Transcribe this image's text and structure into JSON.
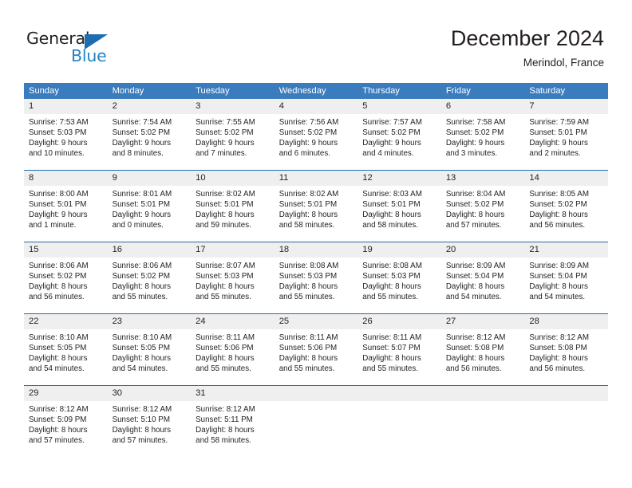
{
  "brand": {
    "name_top": "General",
    "name_bottom": "Blue",
    "triangle_color": "#1f6cb0",
    "blue_color": "#2283c5"
  },
  "header": {
    "title": "December 2024",
    "subtitle": "Merindol, France"
  },
  "theme": {
    "header_bg": "#3a7cbe",
    "header_text": "#ffffff",
    "week_rule": "#1f6cb0",
    "daynum_bg": "#efefef",
    "text": "#231f20"
  },
  "weekday_headers": [
    "Sunday",
    "Monday",
    "Tuesday",
    "Wednesday",
    "Thursday",
    "Friday",
    "Saturday"
  ],
  "weeks": [
    [
      {
        "day": "1",
        "sunrise": "Sunrise: 7:53 AM",
        "sunset": "Sunset: 5:03 PM",
        "daylight_1": "Daylight: 9 hours",
        "daylight_2": "and 10 minutes."
      },
      {
        "day": "2",
        "sunrise": "Sunrise: 7:54 AM",
        "sunset": "Sunset: 5:02 PM",
        "daylight_1": "Daylight: 9 hours",
        "daylight_2": "and 8 minutes."
      },
      {
        "day": "3",
        "sunrise": "Sunrise: 7:55 AM",
        "sunset": "Sunset: 5:02 PM",
        "daylight_1": "Daylight: 9 hours",
        "daylight_2": "and 7 minutes."
      },
      {
        "day": "4",
        "sunrise": "Sunrise: 7:56 AM",
        "sunset": "Sunset: 5:02 PM",
        "daylight_1": "Daylight: 9 hours",
        "daylight_2": "and 6 minutes."
      },
      {
        "day": "5",
        "sunrise": "Sunrise: 7:57 AM",
        "sunset": "Sunset: 5:02 PM",
        "daylight_1": "Daylight: 9 hours",
        "daylight_2": "and 4 minutes."
      },
      {
        "day": "6",
        "sunrise": "Sunrise: 7:58 AM",
        "sunset": "Sunset: 5:02 PM",
        "daylight_1": "Daylight: 9 hours",
        "daylight_2": "and 3 minutes."
      },
      {
        "day": "7",
        "sunrise": "Sunrise: 7:59 AM",
        "sunset": "Sunset: 5:01 PM",
        "daylight_1": "Daylight: 9 hours",
        "daylight_2": "and 2 minutes."
      }
    ],
    [
      {
        "day": "8",
        "sunrise": "Sunrise: 8:00 AM",
        "sunset": "Sunset: 5:01 PM",
        "daylight_1": "Daylight: 9 hours",
        "daylight_2": "and 1 minute."
      },
      {
        "day": "9",
        "sunrise": "Sunrise: 8:01 AM",
        "sunset": "Sunset: 5:01 PM",
        "daylight_1": "Daylight: 9 hours",
        "daylight_2": "and 0 minutes."
      },
      {
        "day": "10",
        "sunrise": "Sunrise: 8:02 AM",
        "sunset": "Sunset: 5:01 PM",
        "daylight_1": "Daylight: 8 hours",
        "daylight_2": "and 59 minutes."
      },
      {
        "day": "11",
        "sunrise": "Sunrise: 8:02 AM",
        "sunset": "Sunset: 5:01 PM",
        "daylight_1": "Daylight: 8 hours",
        "daylight_2": "and 58 minutes."
      },
      {
        "day": "12",
        "sunrise": "Sunrise: 8:03 AM",
        "sunset": "Sunset: 5:01 PM",
        "daylight_1": "Daylight: 8 hours",
        "daylight_2": "and 58 minutes."
      },
      {
        "day": "13",
        "sunrise": "Sunrise: 8:04 AM",
        "sunset": "Sunset: 5:02 PM",
        "daylight_1": "Daylight: 8 hours",
        "daylight_2": "and 57 minutes."
      },
      {
        "day": "14",
        "sunrise": "Sunrise: 8:05 AM",
        "sunset": "Sunset: 5:02 PM",
        "daylight_1": "Daylight: 8 hours",
        "daylight_2": "and 56 minutes."
      }
    ],
    [
      {
        "day": "15",
        "sunrise": "Sunrise: 8:06 AM",
        "sunset": "Sunset: 5:02 PM",
        "daylight_1": "Daylight: 8 hours",
        "daylight_2": "and 56 minutes."
      },
      {
        "day": "16",
        "sunrise": "Sunrise: 8:06 AM",
        "sunset": "Sunset: 5:02 PM",
        "daylight_1": "Daylight: 8 hours",
        "daylight_2": "and 55 minutes."
      },
      {
        "day": "17",
        "sunrise": "Sunrise: 8:07 AM",
        "sunset": "Sunset: 5:03 PM",
        "daylight_1": "Daylight: 8 hours",
        "daylight_2": "and 55 minutes."
      },
      {
        "day": "18",
        "sunrise": "Sunrise: 8:08 AM",
        "sunset": "Sunset: 5:03 PM",
        "daylight_1": "Daylight: 8 hours",
        "daylight_2": "and 55 minutes."
      },
      {
        "day": "19",
        "sunrise": "Sunrise: 8:08 AM",
        "sunset": "Sunset: 5:03 PM",
        "daylight_1": "Daylight: 8 hours",
        "daylight_2": "and 55 minutes."
      },
      {
        "day": "20",
        "sunrise": "Sunrise: 8:09 AM",
        "sunset": "Sunset: 5:04 PM",
        "daylight_1": "Daylight: 8 hours",
        "daylight_2": "and 54 minutes."
      },
      {
        "day": "21",
        "sunrise": "Sunrise: 8:09 AM",
        "sunset": "Sunset: 5:04 PM",
        "daylight_1": "Daylight: 8 hours",
        "daylight_2": "and 54 minutes."
      }
    ],
    [
      {
        "day": "22",
        "sunrise": "Sunrise: 8:10 AM",
        "sunset": "Sunset: 5:05 PM",
        "daylight_1": "Daylight: 8 hours",
        "daylight_2": "and 54 minutes."
      },
      {
        "day": "23",
        "sunrise": "Sunrise: 8:10 AM",
        "sunset": "Sunset: 5:05 PM",
        "daylight_1": "Daylight: 8 hours",
        "daylight_2": "and 54 minutes."
      },
      {
        "day": "24",
        "sunrise": "Sunrise: 8:11 AM",
        "sunset": "Sunset: 5:06 PM",
        "daylight_1": "Daylight: 8 hours",
        "daylight_2": "and 55 minutes."
      },
      {
        "day": "25",
        "sunrise": "Sunrise: 8:11 AM",
        "sunset": "Sunset: 5:06 PM",
        "daylight_1": "Daylight: 8 hours",
        "daylight_2": "and 55 minutes."
      },
      {
        "day": "26",
        "sunrise": "Sunrise: 8:11 AM",
        "sunset": "Sunset: 5:07 PM",
        "daylight_1": "Daylight: 8 hours",
        "daylight_2": "and 55 minutes."
      },
      {
        "day": "27",
        "sunrise": "Sunrise: 8:12 AM",
        "sunset": "Sunset: 5:08 PM",
        "daylight_1": "Daylight: 8 hours",
        "daylight_2": "and 56 minutes."
      },
      {
        "day": "28",
        "sunrise": "Sunrise: 8:12 AM",
        "sunset": "Sunset: 5:08 PM",
        "daylight_1": "Daylight: 8 hours",
        "daylight_2": "and 56 minutes."
      }
    ],
    [
      {
        "day": "29",
        "sunrise": "Sunrise: 8:12 AM",
        "sunset": "Sunset: 5:09 PM",
        "daylight_1": "Daylight: 8 hours",
        "daylight_2": "and 57 minutes."
      },
      {
        "day": "30",
        "sunrise": "Sunrise: 8:12 AM",
        "sunset": "Sunset: 5:10 PM",
        "daylight_1": "Daylight: 8 hours",
        "daylight_2": "and 57 minutes."
      },
      {
        "day": "31",
        "sunrise": "Sunrise: 8:12 AM",
        "sunset": "Sunset: 5:11 PM",
        "daylight_1": "Daylight: 8 hours",
        "daylight_2": "and 58 minutes."
      },
      {
        "day": "",
        "sunrise": "",
        "sunset": "",
        "daylight_1": "",
        "daylight_2": ""
      },
      {
        "day": "",
        "sunrise": "",
        "sunset": "",
        "daylight_1": "",
        "daylight_2": ""
      },
      {
        "day": "",
        "sunrise": "",
        "sunset": "",
        "daylight_1": "",
        "daylight_2": ""
      },
      {
        "day": "",
        "sunrise": "",
        "sunset": "",
        "daylight_1": "",
        "daylight_2": ""
      }
    ]
  ]
}
